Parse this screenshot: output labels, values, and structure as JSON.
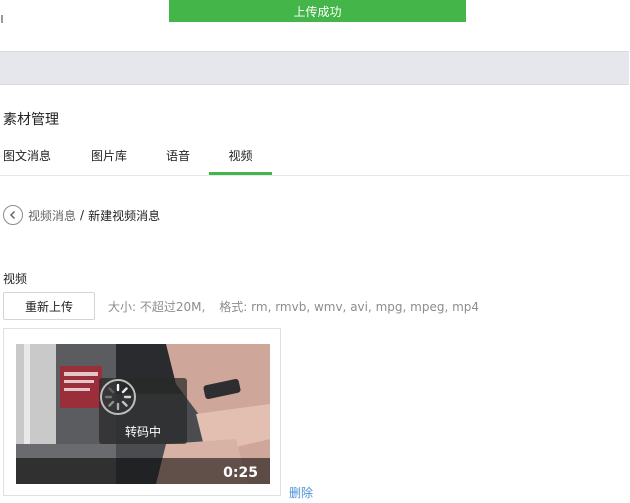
{
  "toast": {
    "text": "上传成功"
  },
  "page": {
    "title": "素材管理"
  },
  "tabs": [
    {
      "label": "图文消息"
    },
    {
      "label": "图片库"
    },
    {
      "label": "语音"
    },
    {
      "label": "视频",
      "active": true
    }
  ],
  "breadcrumb": {
    "back_icon": "chevron-left-icon",
    "parent": "视频消息",
    "separator": "/",
    "current": "新建视频消息"
  },
  "video_field": {
    "label": "视频",
    "reupload_label": "重新上传",
    "size_tip": "大小: 不超过20M,",
    "format_tip": "格式: rm, rmvb, wmv, avi, mpg, mpeg, mp4"
  },
  "video_preview": {
    "status": "转码中",
    "duration": "0:25",
    "spinner_icon": "loading-spinner-icon"
  },
  "actions": {
    "delete_label": "删除"
  },
  "colors": {
    "accent": "#44b549",
    "link": "#4a90d9",
    "muted": "#8d8d8d"
  }
}
